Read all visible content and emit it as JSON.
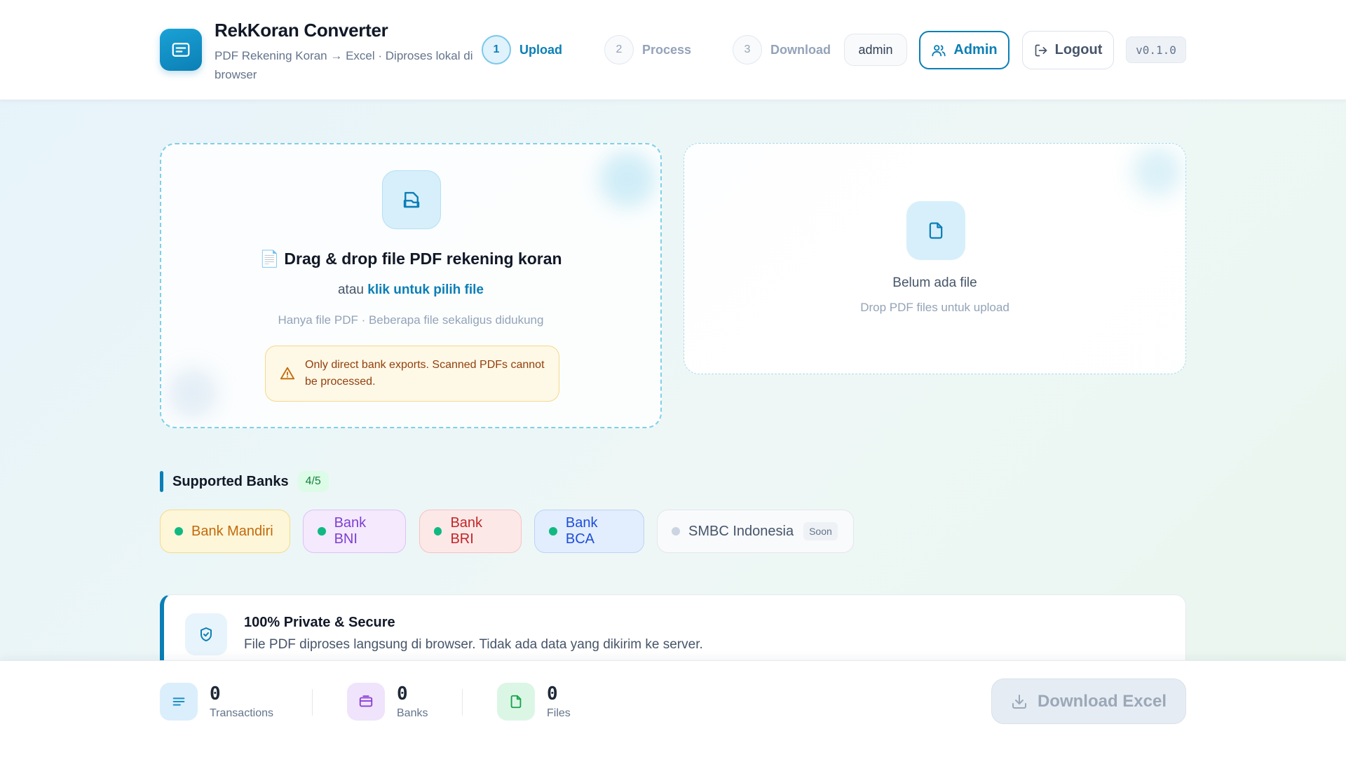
{
  "header": {
    "app_title": "RekKoran Converter",
    "app_subtitle": "PDF Rekening Koran → Excel · Diproses lokal di browser",
    "steps": [
      {
        "number": "1",
        "label": "Upload",
        "active": true
      },
      {
        "number": "2",
        "label": "Process",
        "active": false
      },
      {
        "number": "3",
        "label": "Download",
        "active": false
      }
    ],
    "username": "admin",
    "admin_button": "Admin",
    "logout_button": "Logout",
    "version": "v0.1.0"
  },
  "upload": {
    "title": "📄 Drag & drop file PDF rekening koran",
    "line_prefix": "atau ",
    "link_text": "klik untuk pilih file",
    "hint": "Hanya file PDF · Beberapa file sekaligus didukung",
    "warning": "Only direct bank exports. Scanned PDFs cannot be processed."
  },
  "files": {
    "empty_title": "Belum ada file",
    "empty_hint": "Drop PDF files untuk upload"
  },
  "banks": {
    "title": "Supported Banks",
    "count": "4/5",
    "items": [
      {
        "name": "Bank Mandiri",
        "status": "supported"
      },
      {
        "name": "Bank BNI",
        "status": "supported"
      },
      {
        "name": "Bank BRI",
        "status": "supported"
      },
      {
        "name": "Bank BCA",
        "status": "supported"
      },
      {
        "name": "SMBC Indonesia",
        "status": "soon",
        "badge": "Soon"
      }
    ]
  },
  "privacy": {
    "title": "100% Private & Secure",
    "description": "File PDF diproses langsung di browser. Tidak ada data yang dikirim ke server."
  },
  "stats": [
    {
      "value": "0",
      "label": "Transactions",
      "icon": "list-icon"
    },
    {
      "value": "0",
      "label": "Banks",
      "icon": "card-icon"
    },
    {
      "value": "0",
      "label": "Files",
      "icon": "file-icon"
    }
  ],
  "download_button": "Download Excel",
  "colors": {
    "accent": "#0b7fb5",
    "warning_bg": "#fef8e6",
    "supported_dot": "#10b981"
  }
}
